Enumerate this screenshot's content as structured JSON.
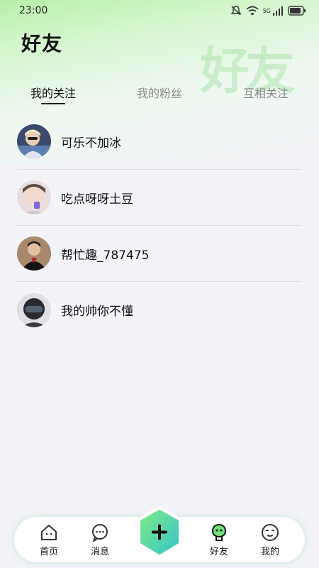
{
  "status_bar": {
    "time": "23:00",
    "network_label": "5G"
  },
  "header": {
    "title": "好友",
    "watermark": "好友"
  },
  "tabs": [
    {
      "label": "我的关注",
      "active": true
    },
    {
      "label": "我的粉丝",
      "active": false
    },
    {
      "label": "互相关注",
      "active": false
    }
  ],
  "friends": [
    {
      "name": "可乐不加冰"
    },
    {
      "name": "吃点呀呀土豆"
    },
    {
      "name": "帮忙趣_787475"
    },
    {
      "name": "我的帅你不懂"
    }
  ],
  "bottom_nav": {
    "items": [
      {
        "label": "首页",
        "icon": "home-icon"
      },
      {
        "label": "消息",
        "icon": "message-icon"
      },
      {
        "label": "好友",
        "icon": "friends-icon",
        "active": true
      },
      {
        "label": "我的",
        "icon": "profile-icon"
      }
    ],
    "add_icon": "plus-icon"
  },
  "colors": {
    "accent_green": "#6ee07a",
    "accent_teal": "#3fc9c0",
    "text": "#111111",
    "muted": "#888888"
  }
}
